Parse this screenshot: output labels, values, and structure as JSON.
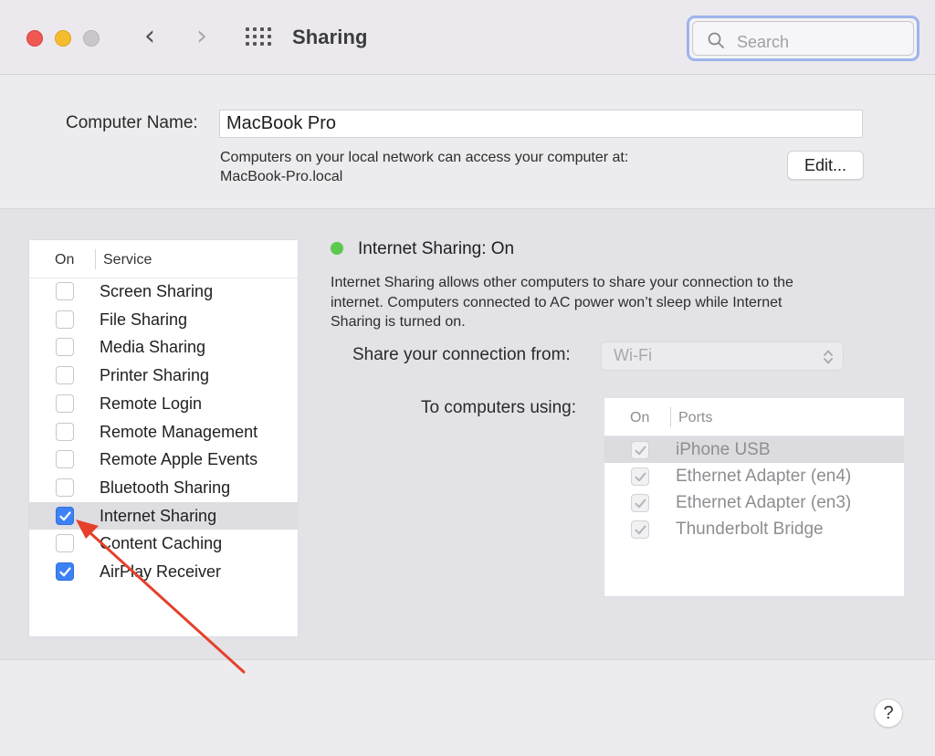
{
  "window": {
    "title": "Sharing",
    "nav_back": "‹",
    "nav_forward": "›",
    "search_placeholder": "Search"
  },
  "computer": {
    "name_label": "Computer Name:",
    "name_value": "MacBook Pro",
    "info_line1": "Computers on your local network can access your computer at:",
    "info_line2": "MacBook-Pro.local",
    "edit_label": "Edit..."
  },
  "services": {
    "header_on": "On",
    "header_service": "Service",
    "items": [
      {
        "label": "Screen Sharing",
        "checked": false
      },
      {
        "label": "File Sharing",
        "checked": false
      },
      {
        "label": "Media Sharing",
        "checked": false
      },
      {
        "label": "Printer Sharing",
        "checked": false
      },
      {
        "label": "Remote Login",
        "checked": false
      },
      {
        "label": "Remote Management",
        "checked": false
      },
      {
        "label": "Remote Apple Events",
        "checked": false
      },
      {
        "label": "Bluetooth Sharing",
        "checked": false
      },
      {
        "label": "Internet Sharing",
        "checked": true,
        "selected": true
      },
      {
        "label": "Content Caching",
        "checked": false
      },
      {
        "label": "AirPlay Receiver",
        "checked": true
      }
    ]
  },
  "detail": {
    "status_title": "Internet Sharing: On",
    "status_color": "#5bc84e",
    "description_line1": "Internet Sharing allows other computers to share your connection to the",
    "description_line2": "internet. Computers connected to AC power won’t sleep while Internet",
    "description_line3": "Sharing is turned on.",
    "share_from_label": "Share your connection from:",
    "share_from_value": "Wi-Fi",
    "to_label": "To computers using:",
    "ports_header_on": "On",
    "ports_header_ports": "Ports",
    "ports": [
      {
        "label": "iPhone USB",
        "checked": true,
        "selected": true
      },
      {
        "label": "Ethernet Adapter (en4)",
        "checked": true
      },
      {
        "label": "Ethernet Adapter (en3)",
        "checked": true
      },
      {
        "label": "Thunderbolt Bridge",
        "checked": true
      }
    ]
  },
  "help_label": "?",
  "colors": {
    "accent": "#3d82f5",
    "annotation_arrow": "#e4402b"
  }
}
